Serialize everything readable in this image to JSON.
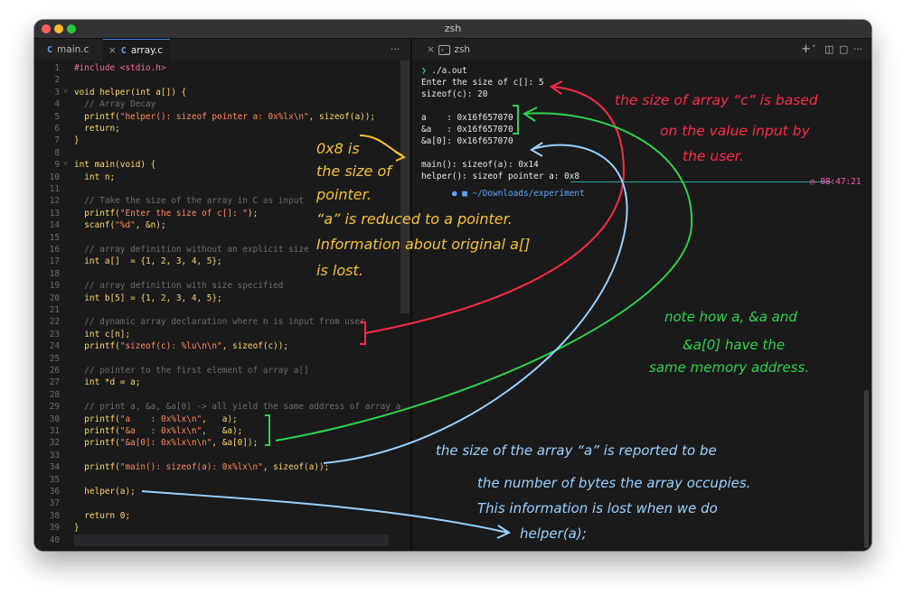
{
  "window": {
    "title": "zsh"
  },
  "editor": {
    "tabs": [
      {
        "label": "main.c",
        "icon": "C"
      },
      {
        "label": "array.c",
        "icon": "C",
        "close": "×"
      }
    ],
    "more_label": "···",
    "current_line": 40,
    "lines": [
      {
        "n": "1",
        "fold": "",
        "segs": [
          {
            "t": "#include <stdio.h>",
            "c": "#f36fa0"
          }
        ]
      },
      {
        "n": "2",
        "fold": "",
        "segs": []
      },
      {
        "n": "3",
        "fold": "˅",
        "segs": [
          {
            "t": "void helper(int a[]) {",
            "c": "#ffd86b"
          }
        ]
      },
      {
        "n": "4",
        "fold": "",
        "segs": [
          {
            "t": "  // Array Decay",
            "c": "#6c6c6c"
          }
        ]
      },
      {
        "n": "5",
        "fold": "",
        "segs": [
          {
            "t": "  printf(",
            "c": "#ffd86b"
          },
          {
            "t": "\"helper(): sizeof pointer a: 0x%lx\\n\"",
            "c": "#ff8a5c"
          },
          {
            "t": ", sizeof(a));",
            "c": "#ffd86b"
          }
        ]
      },
      {
        "n": "6",
        "fold": "",
        "segs": [
          {
            "t": "  return;",
            "c": "#ffd86b"
          }
        ]
      },
      {
        "n": "7",
        "fold": "",
        "segs": [
          {
            "t": "}",
            "c": "#ffd86b"
          }
        ]
      },
      {
        "n": "8",
        "fold": "",
        "segs": []
      },
      {
        "n": "9",
        "fold": "˅",
        "segs": [
          {
            "t": "int main(void) {",
            "c": "#ffd86b"
          }
        ]
      },
      {
        "n": "10",
        "fold": "",
        "segs": [
          {
            "t": "  int n;",
            "c": "#ffd86b"
          }
        ]
      },
      {
        "n": "11",
        "fold": "",
        "segs": []
      },
      {
        "n": "12",
        "fold": "",
        "segs": [
          {
            "t": "  // Take the size of the array in C as input",
            "c": "#6c6c6c"
          }
        ]
      },
      {
        "n": "13",
        "fold": "",
        "segs": [
          {
            "t": "  printf(",
            "c": "#ffd86b"
          },
          {
            "t": "\"Enter the size of c[]: \"",
            "c": "#ff8a5c"
          },
          {
            "t": ");",
            "c": "#ffd86b"
          }
        ]
      },
      {
        "n": "14",
        "fold": "",
        "segs": [
          {
            "t": "  scanf(",
            "c": "#ffd86b"
          },
          {
            "t": "\"%d\"",
            "c": "#ff8a5c"
          },
          {
            "t": ", &n);",
            "c": "#ffd86b"
          }
        ]
      },
      {
        "n": "15",
        "fold": "",
        "segs": []
      },
      {
        "n": "16",
        "fold": "",
        "segs": [
          {
            "t": "  // array definition without an explicit size",
            "c": "#6c6c6c"
          }
        ]
      },
      {
        "n": "17",
        "fold": "",
        "segs": [
          {
            "t": "  int a[]  = {1, 2, 3, 4, 5};",
            "c": "#ffd86b"
          }
        ]
      },
      {
        "n": "18",
        "fold": "",
        "segs": []
      },
      {
        "n": "19",
        "fold": "",
        "segs": [
          {
            "t": "  // array definition with size specified",
            "c": "#6c6c6c"
          }
        ]
      },
      {
        "n": "20",
        "fold": "",
        "segs": [
          {
            "t": "  int b[5] = {1, 2, 3, 4, 5};",
            "c": "#ffd86b"
          }
        ]
      },
      {
        "n": "21",
        "fold": "",
        "segs": []
      },
      {
        "n": "22",
        "fold": "",
        "segs": [
          {
            "t": "  // dynamic array declaration where n is input from user",
            "c": "#6c6c6c"
          }
        ]
      },
      {
        "n": "23",
        "fold": "",
        "segs": [
          {
            "t": "  int c[n];",
            "c": "#ffd86b"
          }
        ]
      },
      {
        "n": "24",
        "fold": "",
        "segs": [
          {
            "t": "  printf(",
            "c": "#ffd86b"
          },
          {
            "t": "\"sizeof(c): %lu\\n\\n\"",
            "c": "#ff8a5c"
          },
          {
            "t": ", sizeof(c));",
            "c": "#ffd86b"
          }
        ]
      },
      {
        "n": "25",
        "fold": "",
        "segs": []
      },
      {
        "n": "26",
        "fold": "",
        "segs": [
          {
            "t": "  // pointer to the first element of array a[]",
            "c": "#6c6c6c"
          }
        ]
      },
      {
        "n": "27",
        "fold": "",
        "segs": [
          {
            "t": "  int *d = a;",
            "c": "#ffd86b"
          }
        ]
      },
      {
        "n": "28",
        "fold": "",
        "segs": []
      },
      {
        "n": "29",
        "fold": "",
        "segs": [
          {
            "t": "  // print a, &a, &a[0] -> all yield the same address of array a",
            "c": "#6c6c6c"
          }
        ]
      },
      {
        "n": "30",
        "fold": "",
        "segs": [
          {
            "t": "  printf(",
            "c": "#ffd86b"
          },
          {
            "t": "\"a    : 0x%lx\\n\"",
            "c": "#ff8a5c"
          },
          {
            "t": ",   a);",
            "c": "#ffd86b"
          }
        ]
      },
      {
        "n": "31",
        "fold": "",
        "segs": [
          {
            "t": "  printf(",
            "c": "#ffd86b"
          },
          {
            "t": "\"&a   : 0x%lx\\n\"",
            "c": "#ff8a5c"
          },
          {
            "t": ",   &a);",
            "c": "#ffd86b"
          }
        ]
      },
      {
        "n": "32",
        "fold": "",
        "segs": [
          {
            "t": "  printf(",
            "c": "#ffd86b"
          },
          {
            "t": "\"&a[0]: 0x%lx\\n\\n\"",
            "c": "#ff8a5c"
          },
          {
            "t": ", &a[0]);",
            "c": "#ffd86b"
          }
        ]
      },
      {
        "n": "33",
        "fold": "",
        "segs": []
      },
      {
        "n": "34",
        "fold": "",
        "segs": [
          {
            "t": "  printf(",
            "c": "#ffd86b"
          },
          {
            "t": "\"main(): sizeof(a): 0x%lx\\n\"",
            "c": "#ff8a5c"
          },
          {
            "t": ", sizeof(a));",
            "c": "#ffd86b"
          }
        ]
      },
      {
        "n": "35",
        "fold": "",
        "segs": []
      },
      {
        "n": "36",
        "fold": "",
        "segs": [
          {
            "t": "  helper(a);",
            "c": "#ffd86b"
          }
        ]
      },
      {
        "n": "37",
        "fold": "",
        "segs": []
      },
      {
        "n": "38",
        "fold": "",
        "segs": [
          {
            "t": "  return 0;",
            "c": "#ffd86b"
          }
        ]
      },
      {
        "n": "39",
        "fold": "",
        "segs": [
          {
            "t": "}",
            "c": "#ffd86b"
          }
        ]
      },
      {
        "n": "40",
        "fold": "",
        "segs": []
      }
    ]
  },
  "terminal": {
    "tab_label": "zsh",
    "tab_icon": "›_",
    "actions": {
      "add": "+",
      "chevron": "˅",
      "split": "◫",
      "lock": "▢",
      "more": "···"
    },
    "prompt_symbol": "❯",
    "command": " ./a.out",
    "output": [
      "Enter the size of c[]: 5",
      "sizeof(c): 20",
      "",
      "a    : 0x16f657070",
      "&a   : 0x16f657070",
      "&a[0]: 0x16f657070",
      "",
      "main(): sizeof(a): 0x14",
      "helper(): sizeof pointer a: 0x8"
    ],
    "path": "~/Downloads/experiment",
    "time": "08:47:21"
  },
  "annotations": {
    "yellow": [
      "0x8 is",
      "the size of",
      "pointer.",
      "“a” is reduced to a pointer.",
      "Information about original a[]",
      "is lost."
    ],
    "red": [
      "the size of array “c” is based",
      "on the value input by",
      "the user."
    ],
    "green": [
      "note how a, &a and",
      "&a[0] have the",
      "same memory address."
    ],
    "blue": [
      "the size of the array “a” is reported to be",
      "the number of bytes the array occupies.",
      "This information is lost when we do",
      "helper(a);"
    ]
  },
  "colors": {
    "yellow": "#f6c234",
    "red": "#ff2b46",
    "green": "#2fd34d",
    "blue": "#9bd2ff"
  }
}
